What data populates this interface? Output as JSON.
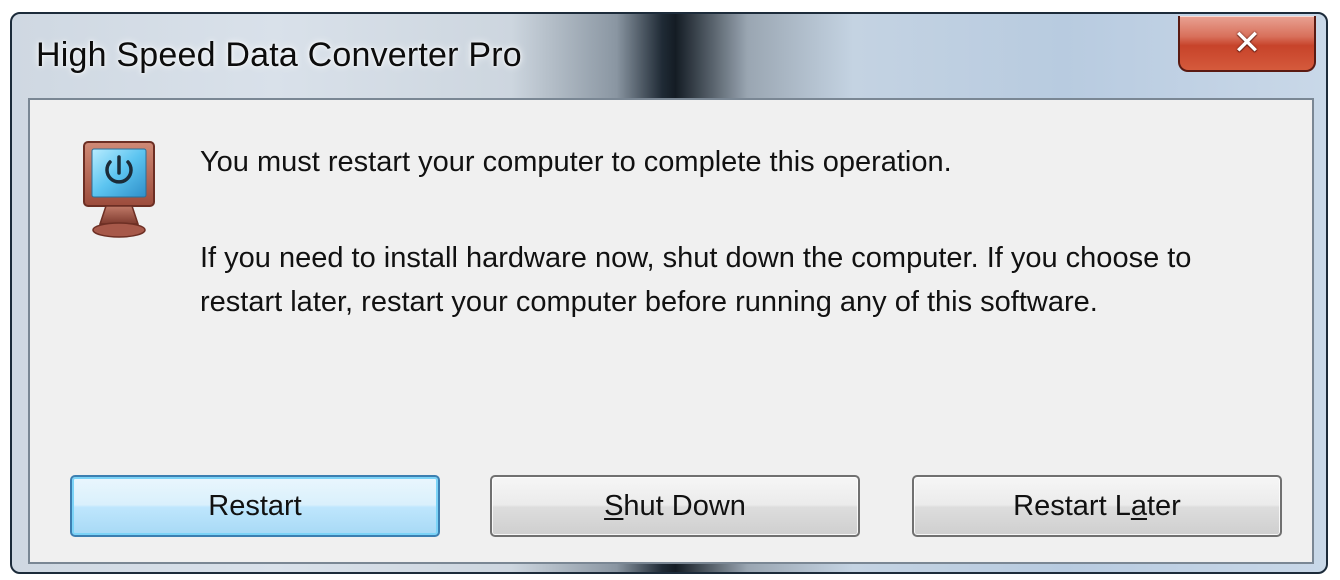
{
  "window": {
    "title": "High Speed Data Converter Pro",
    "close_glyph": "✕"
  },
  "icon": {
    "name": "power-monitor-icon"
  },
  "message": {
    "line1": "You must restart your computer to complete this operation.",
    "line2": "If you need to install hardware now, shut down the computer. If you choose to restart later, restart your computer before running any of this software."
  },
  "buttons": {
    "restart": "Restart",
    "shutdown": {
      "mnemonic": "S",
      "rest": "hut Down"
    },
    "later": {
      "before": "Restart L",
      "mnemonic": "a",
      "after": "ter"
    }
  },
  "colors": {
    "close_button": "#c7432a",
    "default_button_border": "#3c7fb1",
    "client_background": "#f0f0f0"
  }
}
